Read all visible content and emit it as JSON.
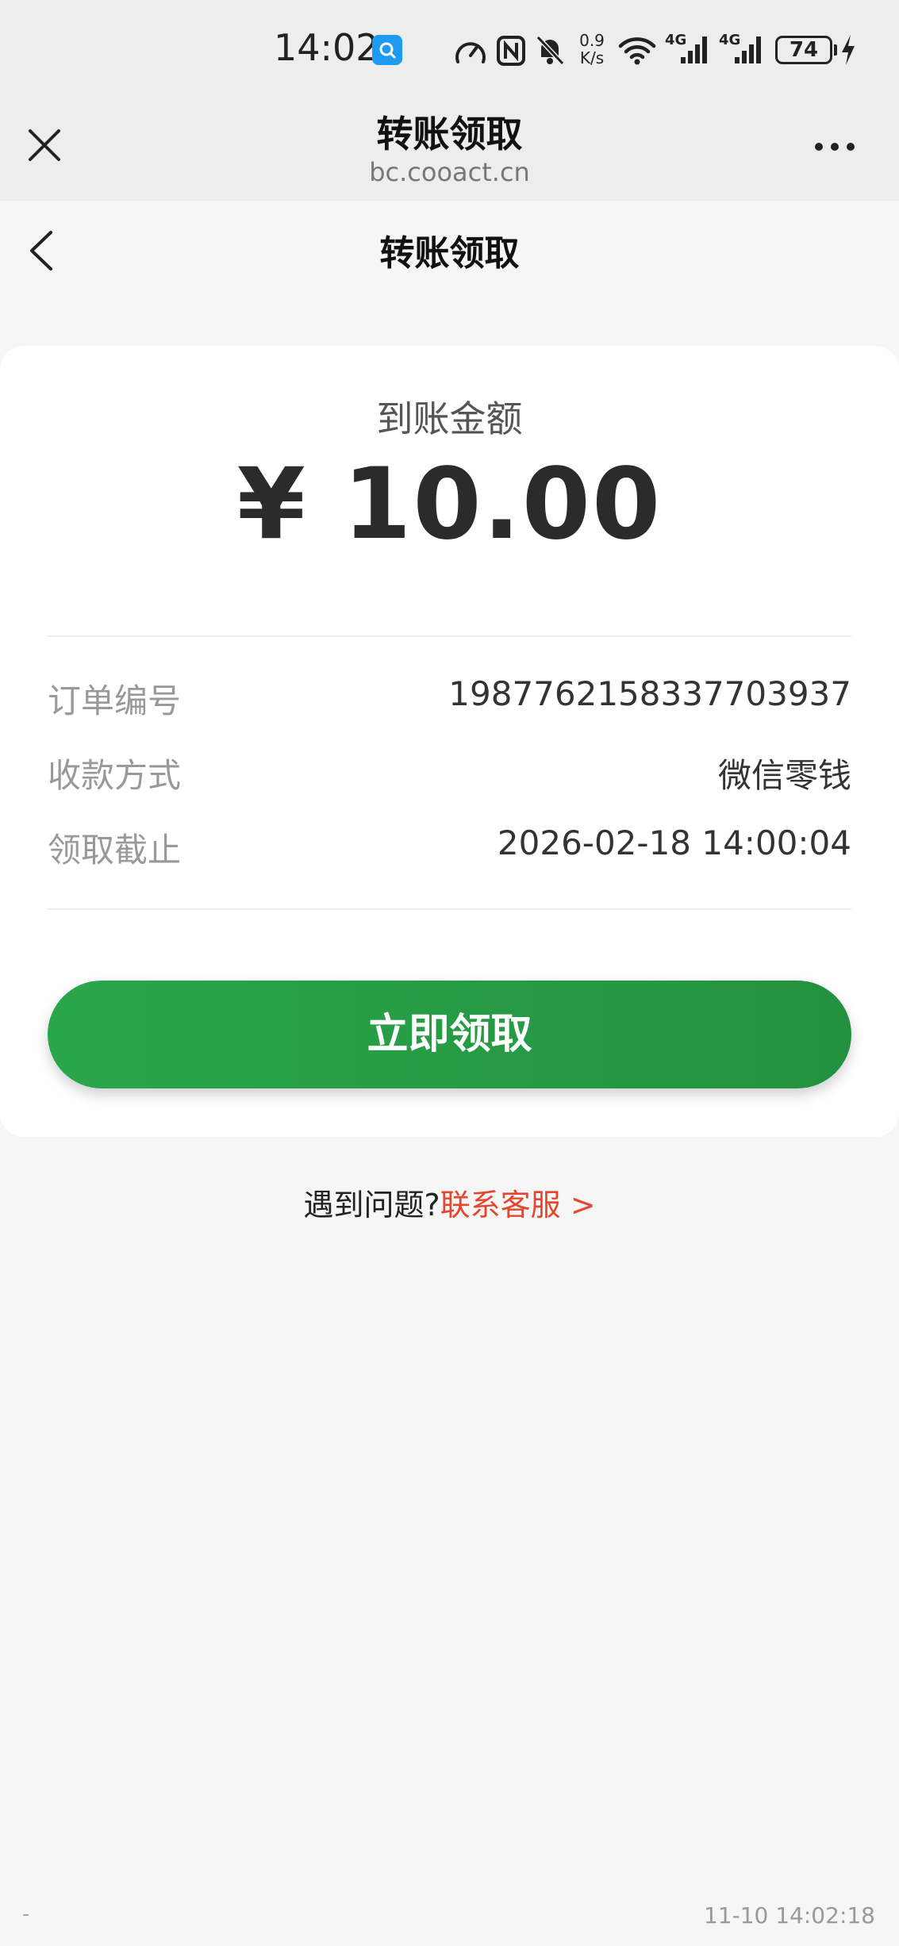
{
  "status_bar": {
    "time": "14:02",
    "net_speed_value": "0.9",
    "net_speed_unit": "K/s",
    "signal1_label": "4G",
    "signal2_label": "4G",
    "battery": "74",
    "icons": [
      "qq-app-icon",
      "speedometer-icon",
      "nfc-icon",
      "mute-bell-icon",
      "wifi-icon",
      "signal-icon",
      "signal-icon",
      "battery-icon",
      "charging-icon"
    ]
  },
  "browser": {
    "title": "转账领取",
    "url": "bc.cooact.cn"
  },
  "page": {
    "title": "转账领取"
  },
  "card": {
    "amount_label": "到账金额",
    "amount": "¥ 10.00",
    "rows": [
      {
        "label": "订单编号",
        "value": "1987762158337703937"
      },
      {
        "label": "收款方式",
        "value": "微信零钱"
      },
      {
        "label": "领取截止",
        "value": "2026-02-18 14:00:04"
      }
    ],
    "button_label": "立即领取"
  },
  "help": {
    "text": "遇到问题?",
    "link": "联系客服 >"
  },
  "footer": {
    "dash": "-",
    "time": "11-10 14:02:18"
  },
  "colors": {
    "accent_green": "#2aa64a",
    "link_red": "#e4472b",
    "background": "#f6f6f6"
  }
}
